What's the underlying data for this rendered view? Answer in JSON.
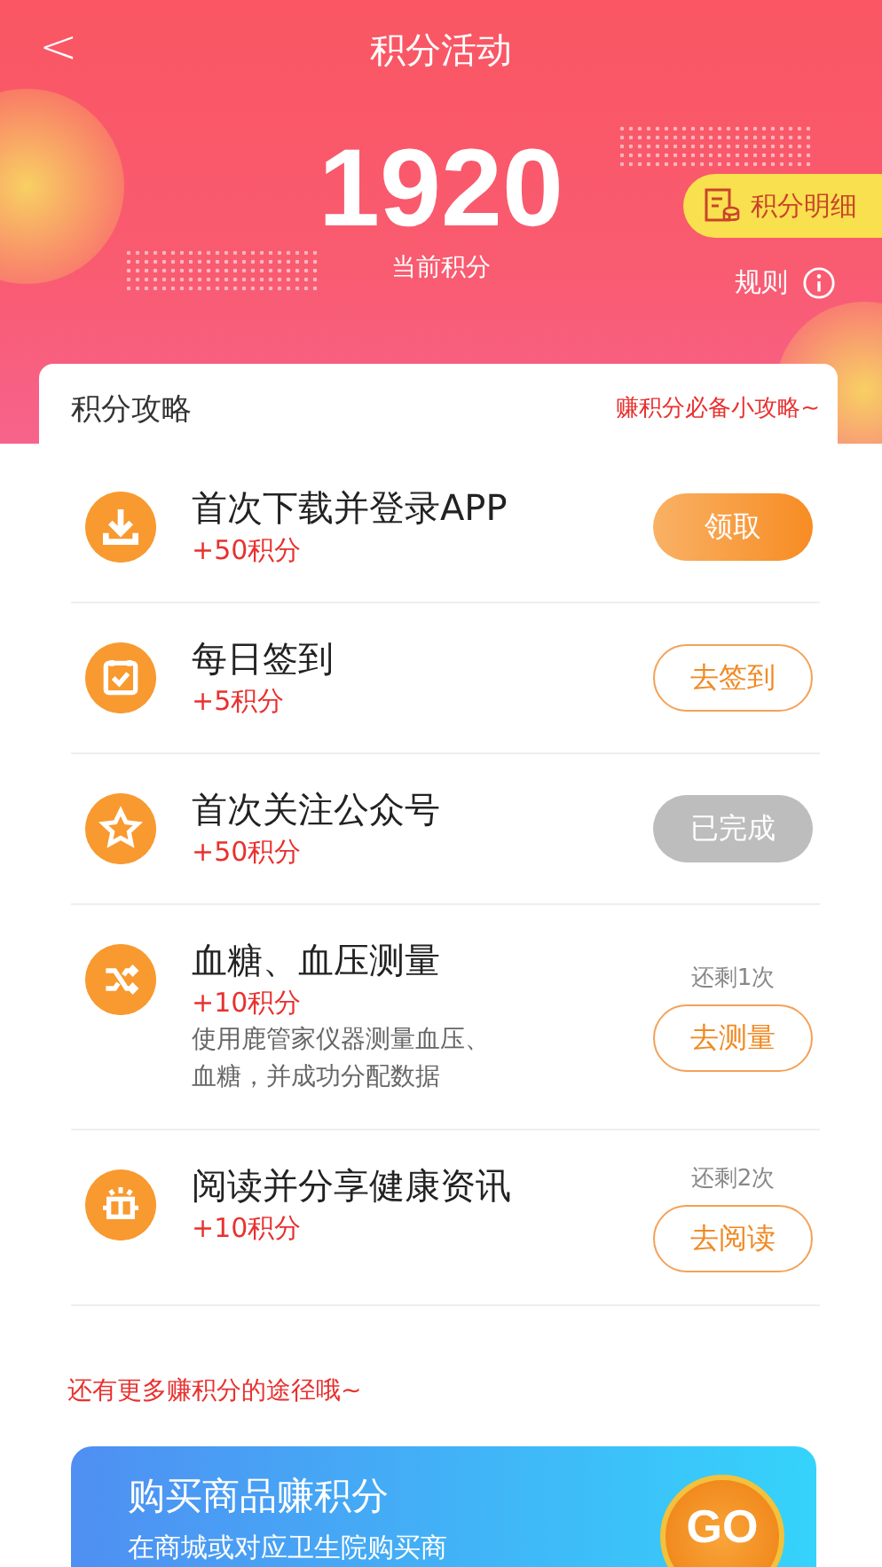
{
  "nav": {
    "back": "<",
    "title": "积分活动"
  },
  "points": {
    "value": "1920",
    "label": "当前积分",
    "detail_button": "积分明细",
    "rules": "规则"
  },
  "guide": {
    "title": "积分攻略",
    "hint": "赚积分必备小攻略~",
    "tasks": [
      {
        "title": "首次下载并登录APP",
        "reward": "+50积分",
        "button": {
          "kind": "claim",
          "label": "领取"
        }
      },
      {
        "title": "每日签到",
        "reward": "+5积分",
        "button": {
          "kind": "todo",
          "label": "去签到"
        }
      },
      {
        "title": "首次关注公众号",
        "reward": "+50积分",
        "button": {
          "kind": "done",
          "label": "已完成"
        }
      },
      {
        "title": "血糖、血压测量",
        "reward": "+10积分",
        "description": "使用鹿管家仪器测量血压、血糖，并成功分配数据",
        "remaining": "还剩1次",
        "button": {
          "kind": "todo",
          "label": "去测量"
        }
      },
      {
        "title": "阅读并分享健康资讯",
        "reward": "+10积分",
        "remaining": "还剩2次",
        "button": {
          "kind": "todo",
          "label": "去阅读"
        }
      }
    ]
  },
  "more": {
    "text": "还有更多赚积分的途径哦~",
    "banner": {
      "title": "购买商品赚积分",
      "subtitle": "在商城或对应卫生院购买商",
      "button": "GO"
    }
  }
}
